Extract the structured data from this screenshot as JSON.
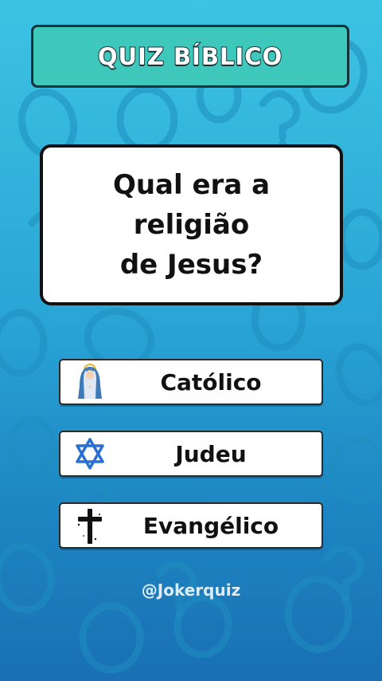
{
  "header": {
    "title": "QUIZ BÍBLICO"
  },
  "question": {
    "line1": "Qual era a religião",
    "line2": "de Jesus?"
  },
  "options": [
    {
      "label": "Católico",
      "icon": "virgin-mary-icon"
    },
    {
      "label": "Judeu",
      "icon": "star-of-david-icon"
    },
    {
      "label": "Evangélico",
      "icon": "cross-icon"
    }
  ],
  "footer": {
    "handle": "@Jokerquiz"
  },
  "colors": {
    "background_top": "#3cc3e3",
    "background_bottom": "#1a6fb4",
    "banner": "#3ec8bb",
    "outline": "#15323a",
    "star": "#2a6fd1"
  }
}
